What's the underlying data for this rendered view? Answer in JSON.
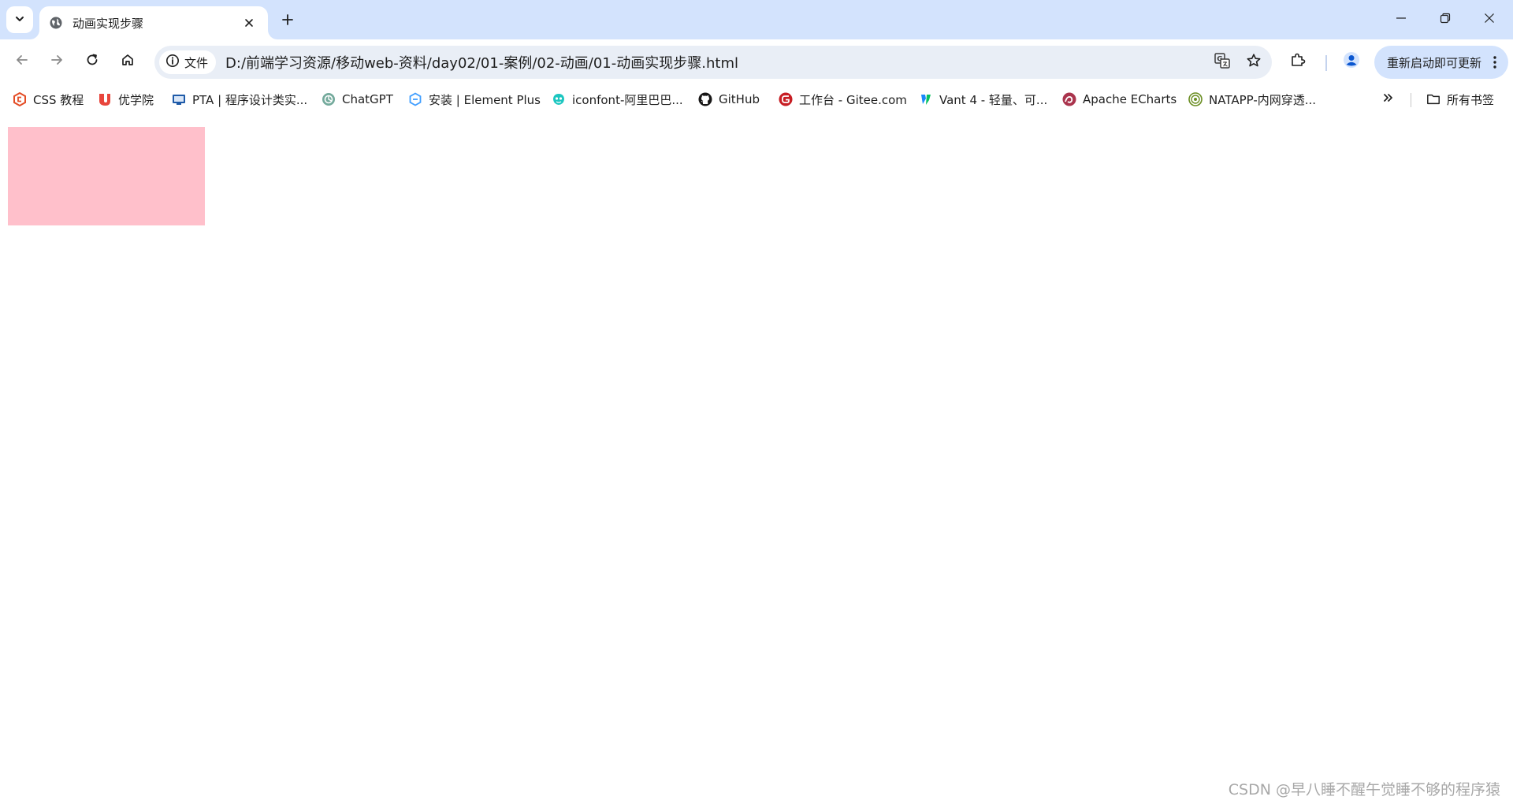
{
  "browser": {
    "tab": {
      "title": "动画实现步骤",
      "favicon": "globe-icon"
    },
    "site_chip_label": "文件",
    "url": "D:/前端学习资源/移动web-资料/day02/01-案例/02-动画/01-动画实现步骤.html",
    "update_button_label": "重新启动即可更新",
    "colors": {
      "tabstrip": "#d3e3fd",
      "omnibox": "#e9eef6",
      "profile": "#0b57d0"
    }
  },
  "bookmarks": {
    "items": [
      {
        "label": "CSS 教程",
        "icon": "css-logo-icon",
        "color": "#e44d26"
      },
      {
        "label": "优学院",
        "icon": "ulearning-logo-icon",
        "color": "#e8453c"
      },
      {
        "label": "PTA | 程序设计类实...",
        "icon": "pta-logo-icon",
        "color": "#1e5aa8"
      },
      {
        "label": "ChatGPT",
        "icon": "chatgpt-logo-icon",
        "color": "#74aa9c"
      },
      {
        "label": "安装 | Element Plus",
        "icon": "element-plus-logo-icon",
        "color": "#409eff"
      },
      {
        "label": "iconfont-阿里巴巴...",
        "icon": "iconfont-logo-icon",
        "color": "#1cc6c0"
      },
      {
        "label": "GitHub",
        "icon": "github-logo-icon",
        "color": "#181717"
      },
      {
        "label": "工作台 - Gitee.com",
        "icon": "gitee-logo-icon",
        "color": "#c71d23"
      },
      {
        "label": "Vant 4 - 轻量、可...",
        "icon": "vant-logo-icon",
        "color": "#1989fa"
      },
      {
        "label": "Apache ECharts",
        "icon": "echarts-logo-icon",
        "color": "#aa344d"
      },
      {
        "label": "NATAPP-内网穿透...",
        "icon": "natapp-logo-icon",
        "color": "#6b8e23"
      }
    ],
    "all_bookmarks_label": "所有书签"
  },
  "page": {
    "box_color": "#ffc0cb"
  },
  "watermark": "CSDN @早八睡不醒午觉睡不够的程序猿"
}
